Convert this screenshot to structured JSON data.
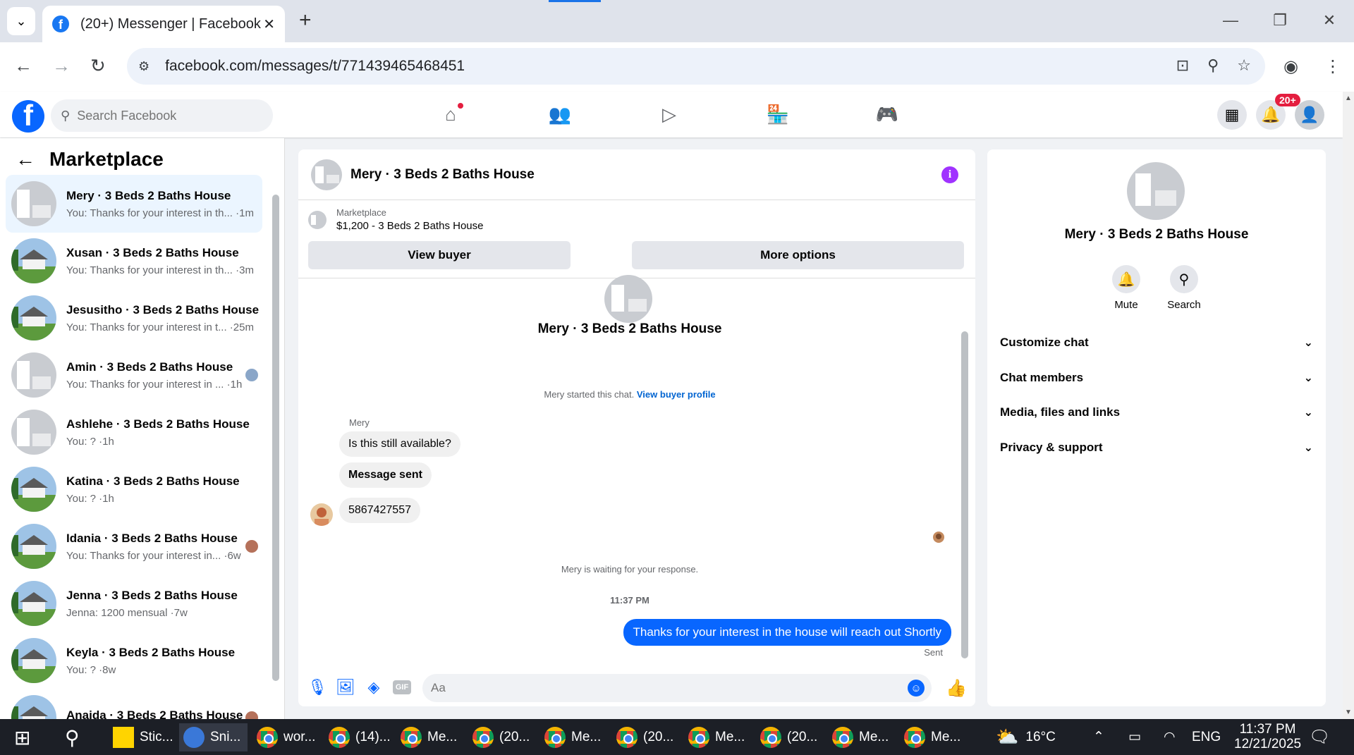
{
  "browser": {
    "tab_title": "(20+) Messenger | Facebook",
    "url": "facebook.com/messages/t/771439465468451"
  },
  "fb_header": {
    "search_placeholder": "Search Facebook",
    "notification_badge": "20+"
  },
  "sidebar": {
    "title": "Marketplace",
    "conversations": [
      {
        "name": "Mery · 3 Beds 2 Baths House",
        "snippet": "You: Thanks for your interest in th... ·1m",
        "active": true
      },
      {
        "name": "Xusan · 3 Beds 2 Baths House",
        "snippet": "You: Thanks for your interest in th... ·3m"
      },
      {
        "name": "Jesusitho · 3 Beds 2 Baths House",
        "snippet": "You: Thanks for your interest in t... ·25m"
      },
      {
        "name": "Amin · 3 Beds 2 Baths House",
        "snippet": "You: Thanks for your interest in ... ·1h"
      },
      {
        "name": "Ashlehe · 3 Beds 2 Baths House",
        "snippet": "You: ? ·1h"
      },
      {
        "name": "Katina · 3 Beds 2 Baths House",
        "snippet": "You: ? ·1h"
      },
      {
        "name": "Idania · 3 Beds 2 Baths House",
        "snippet": "You: Thanks for your interest in... ·6w"
      },
      {
        "name": "Jenna · 3 Beds 2 Baths House",
        "snippet": "Jenna: 1200 mensual ·7w"
      },
      {
        "name": "Keyla · 3 Beds 2 Baths House",
        "snippet": "You: ? ·8w"
      },
      {
        "name": "Anaida · 3 Beds 2 Baths House",
        "snippet": ""
      }
    ]
  },
  "chat": {
    "header_name": "Mery · 3 Beds 2 Baths House",
    "marketplace_label": "Marketplace",
    "listing": "$1,200 - 3 Beds 2 Baths House",
    "view_buyer": "View buyer",
    "more_options": "More options",
    "top_name": "Mery · 3 Beds 2 Baths House",
    "started_text": "Mery started this chat.",
    "view_profile_link": "View buyer profile",
    "sender_name": "Mery",
    "incoming": [
      "Is this still available?",
      "Message sent",
      "5867427557"
    ],
    "waiting_text": "Mery is waiting for your response.",
    "time": "11:37 PM",
    "outgoing": "Thanks for your interest in the house will reach out Shortly",
    "sent_label": "Sent",
    "composer_placeholder": "Aa"
  },
  "info_panel": {
    "name": "Mery · 3 Beds 2 Baths House",
    "mute_label": "Mute",
    "search_label": "Search",
    "sections": [
      "Customize chat",
      "Chat members",
      "Media, files and links",
      "Privacy & support"
    ]
  },
  "taskbar": {
    "items": [
      "Stic...",
      "Sni...",
      "wor...",
      "(14)...",
      "Me...",
      "(20...",
      "Me...",
      "(20...",
      "Me...",
      "(20...",
      "Me...",
      "Me..."
    ],
    "temperature": "16°C",
    "language": "ENG",
    "clock_time": "11:37 PM",
    "clock_date": "12/21/2025"
  },
  "colors": {
    "fb_blue": "#0866ff",
    "active_conv": "#ebf5ff",
    "info_purple": "#a033ff"
  }
}
